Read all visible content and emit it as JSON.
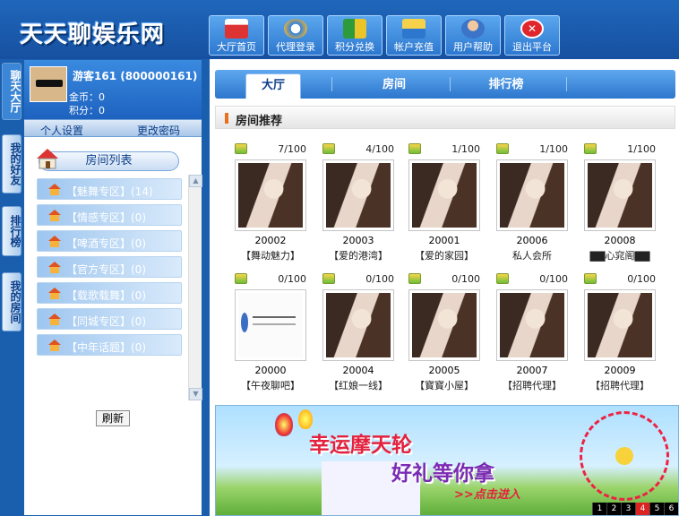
{
  "header": {
    "logo": "天天聊娱乐网",
    "nav": [
      {
        "label": "大厅首页",
        "icon": "house-icon"
      },
      {
        "label": "代理登录",
        "icon": "ie-globe-icon"
      },
      {
        "label": "积分兑换",
        "icon": "gift-box-icon"
      },
      {
        "label": "帐户充值",
        "icon": "card-icon"
      },
      {
        "label": "用户帮助",
        "icon": "user-help-icon"
      },
      {
        "label": "退出平台",
        "icon": "close-icon"
      }
    ]
  },
  "side_tabs": [
    "聊天大厅",
    "我的好友",
    "排行榜",
    "我的房间"
  ],
  "user": {
    "name": "游客161 (800000161)",
    "gold": "金币：0",
    "points": "积分：0",
    "settings": "个人设置",
    "change_password": "更改密码"
  },
  "room_list": {
    "title": "房间列表",
    "categories": [
      "【魅舞专区】(14)",
      "【情感专区】(0)",
      "【啤酒专区】(0)",
      "【官方专区】(0)",
      "【载歌载舞】(0)",
      "【同城专区】(0)",
      "【中年话题】(0)"
    ],
    "refresh": "刷新"
  },
  "tabs": [
    "大厅",
    "房间",
    "排行榜"
  ],
  "section_title": "房间推荐",
  "rooms": [
    {
      "count": "7/100",
      "id": "20002",
      "name": "【舞动魅力】"
    },
    {
      "count": "4/100",
      "id": "20003",
      "name": "【爱的港湾】"
    },
    {
      "count": "1/100",
      "id": "20001",
      "name": "【爱的家园】"
    },
    {
      "count": "1/100",
      "id": "20006",
      "name": "私人会所"
    },
    {
      "count": "1/100",
      "id": "20008",
      "name": "▇▇心窕阁▇▇"
    },
    {
      "count": "0/100",
      "id": "20000",
      "name": "【午夜聊吧】"
    },
    {
      "count": "0/100",
      "id": "20004",
      "name": "【红娘一线】"
    },
    {
      "count": "0/100",
      "id": "20005",
      "name": "【寳寳小屋】"
    },
    {
      "count": "0/100",
      "id": "20007",
      "name": "【招聘代理】"
    },
    {
      "count": "0/100",
      "id": "20009",
      "name": "【招聘代理】"
    }
  ],
  "banner": {
    "line1": "幸运摩天轮",
    "line2": "好礼等你拿",
    "cta": ">>点击进入",
    "pages": [
      "1",
      "2",
      "3",
      "4",
      "5",
      "6"
    ],
    "active_page": "4"
  }
}
